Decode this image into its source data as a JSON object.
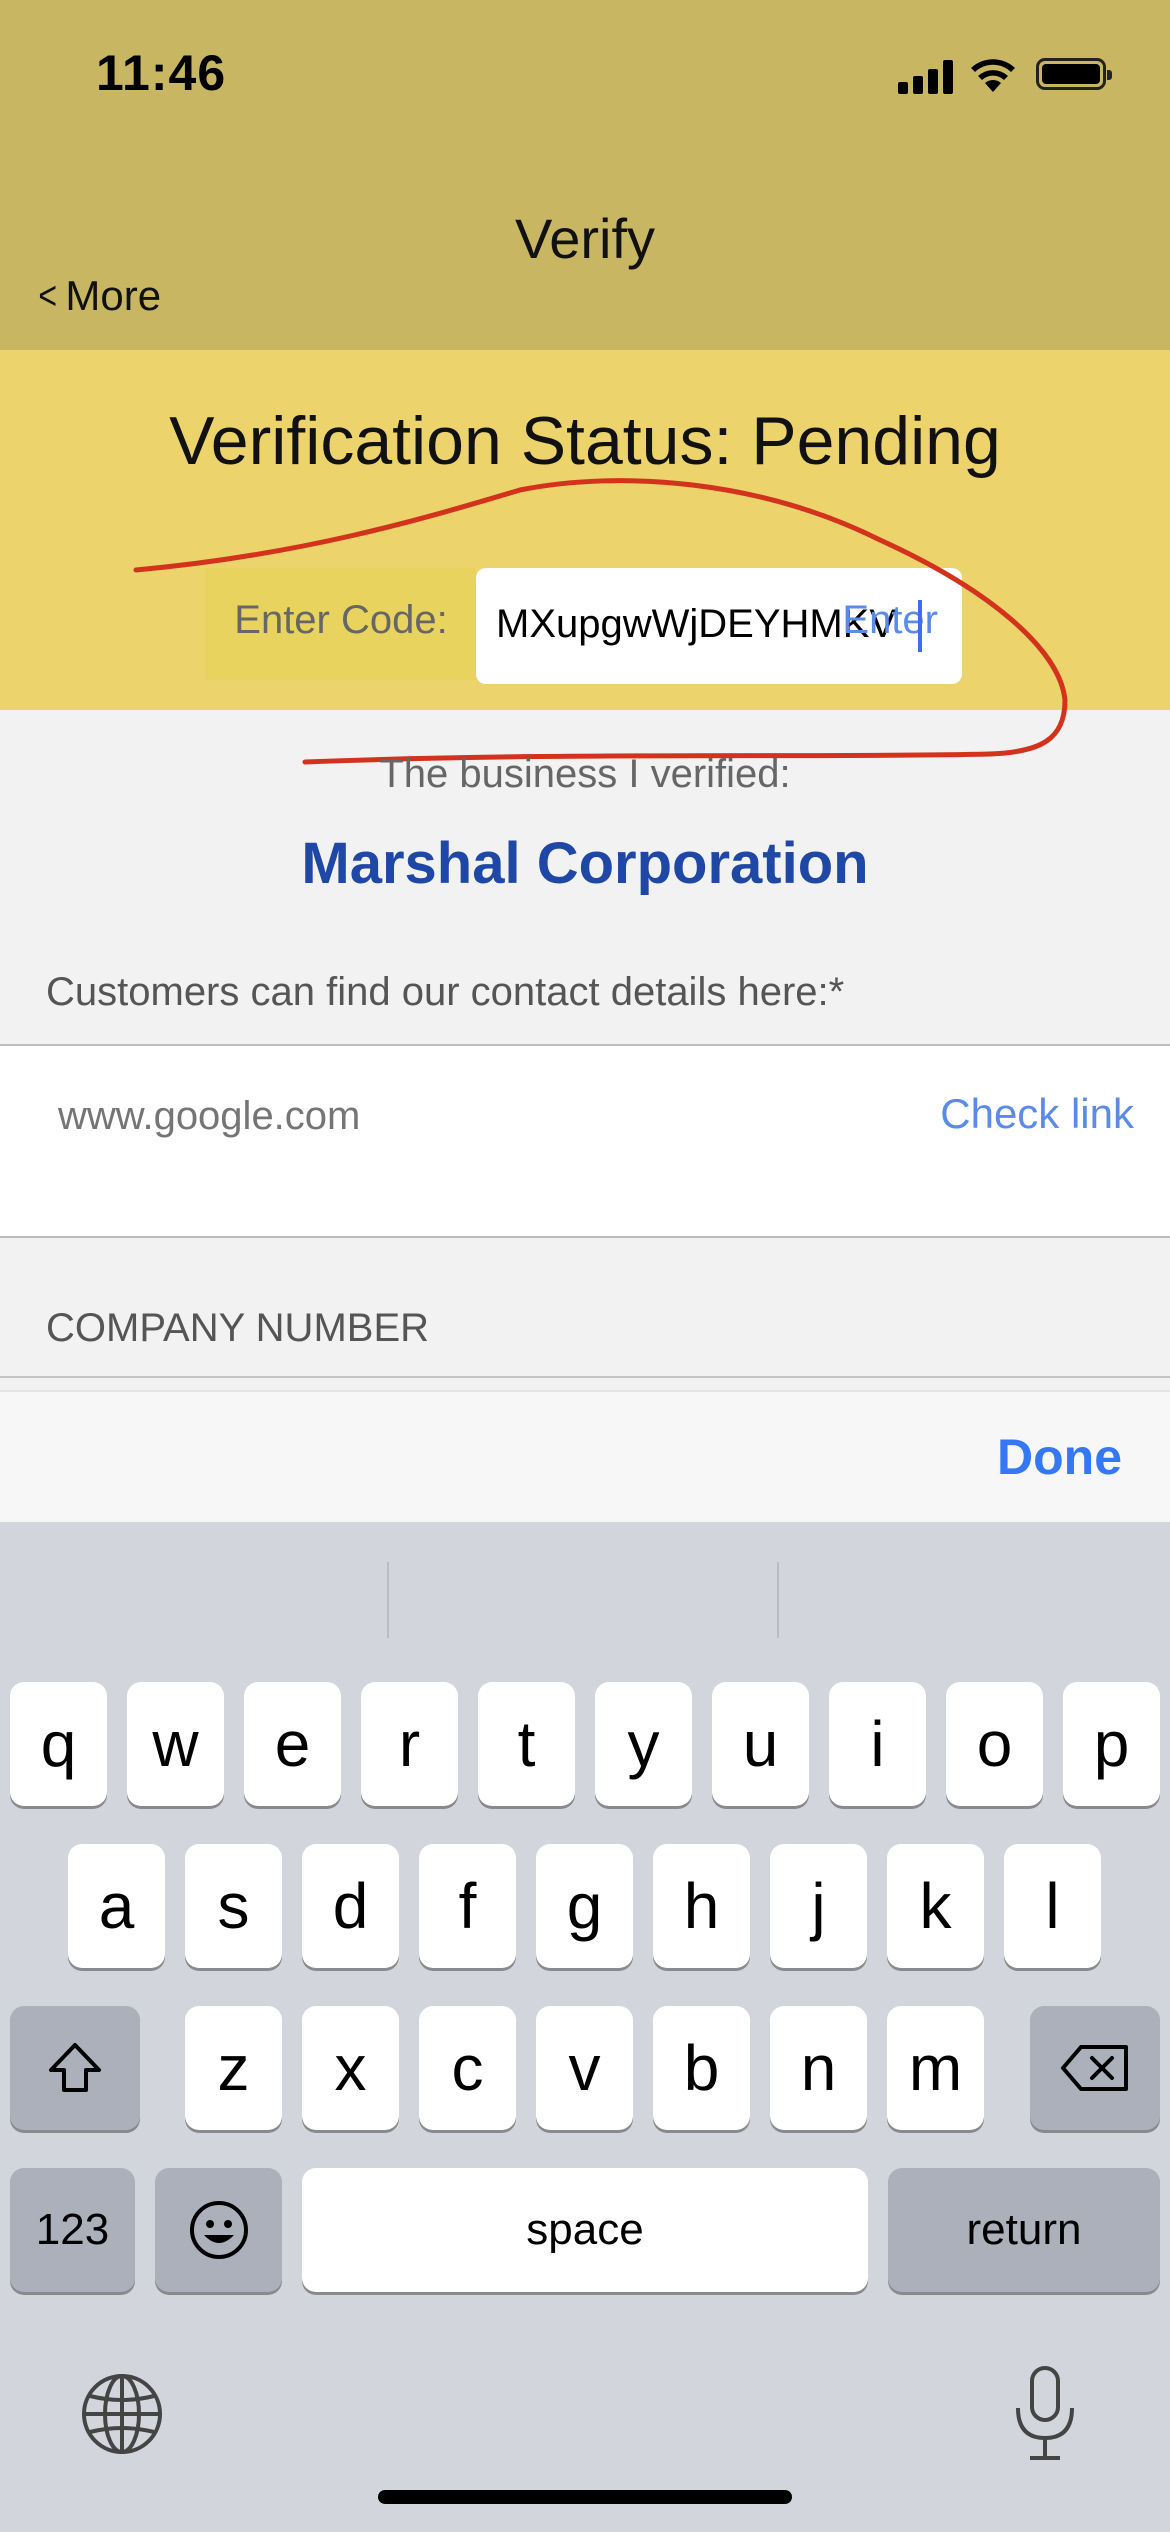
{
  "status_bar": {
    "time": "11:46"
  },
  "nav": {
    "title": "Verify",
    "back_label": "More"
  },
  "verification": {
    "heading": "Verification Status: Pending",
    "code_label": "Enter Code:",
    "code_value": "MXupgwWjDEYHMKV",
    "enter_label": "Enter"
  },
  "business": {
    "caption": "The business I verified:",
    "name": "Marshal Corporation",
    "contact_caption": "Customers can find our contact details here:*",
    "link_placeholder": "www.google.com",
    "check_link_label": "Check link",
    "company_number_label": "COMPANY NUMBER"
  },
  "toolbar": {
    "done_label": "Done"
  },
  "keyboard": {
    "row1": [
      "q",
      "w",
      "e",
      "r",
      "t",
      "y",
      "u",
      "i",
      "o",
      "p"
    ],
    "row2": [
      "a",
      "s",
      "d",
      "f",
      "g",
      "h",
      "j",
      "k",
      "l"
    ],
    "row3": [
      "z",
      "x",
      "c",
      "v",
      "b",
      "n",
      "m"
    ],
    "numbers_label": "123",
    "space_label": "space",
    "return_label": "return"
  },
  "colors": {
    "nav_bar": "#c8b662",
    "status_area": "#ecd36b",
    "business_name": "#1f47a6",
    "link_blue": "#5b8be8",
    "done_blue": "#3478f6",
    "annotation_red": "#d3321c"
  }
}
